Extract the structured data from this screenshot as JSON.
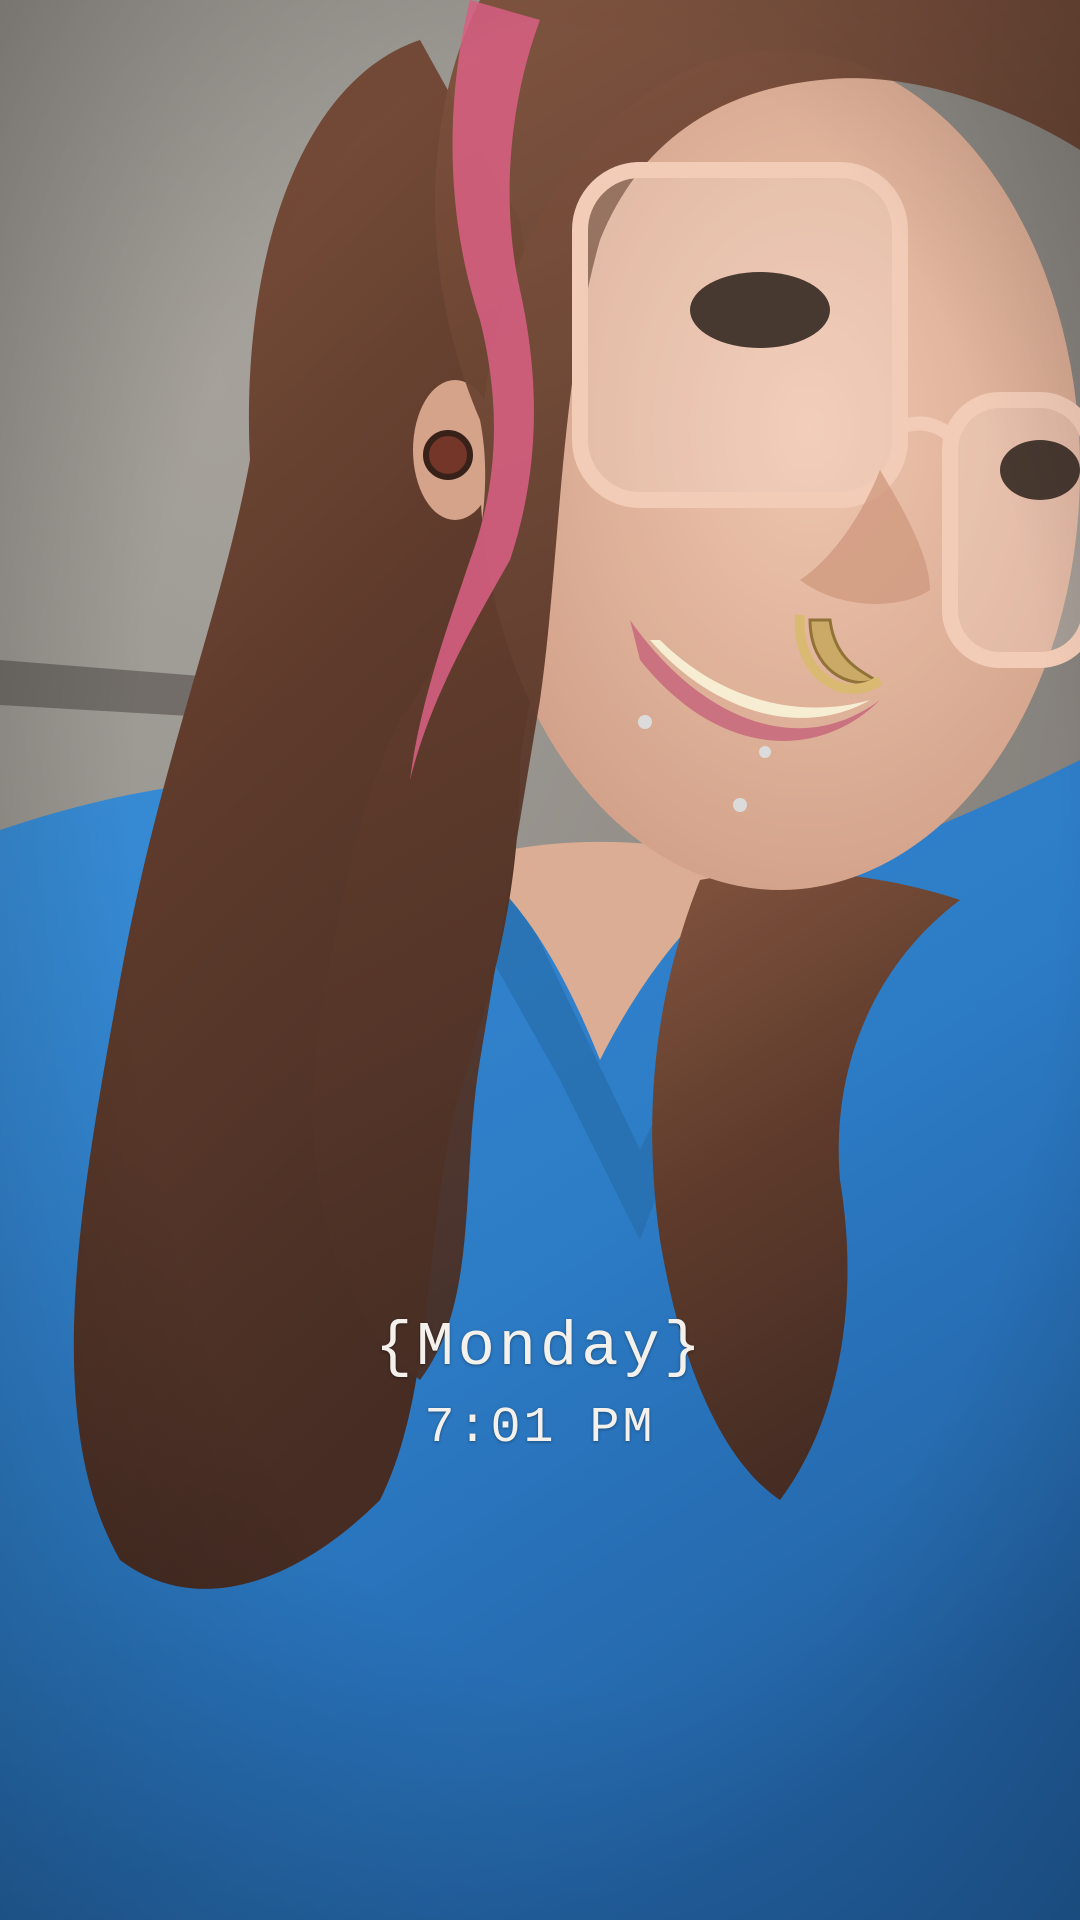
{
  "story": {
    "day_label": "{Monday}",
    "time_label": "7:01 PM"
  },
  "colors": {
    "background_wall": "#8e8a84",
    "shirt_blue": "#1f73c2",
    "hair_brown": "#5a3524",
    "hair_pink": "#d9587f",
    "skin": "#e2b39b",
    "sticker_text": "#f4f1ec"
  }
}
